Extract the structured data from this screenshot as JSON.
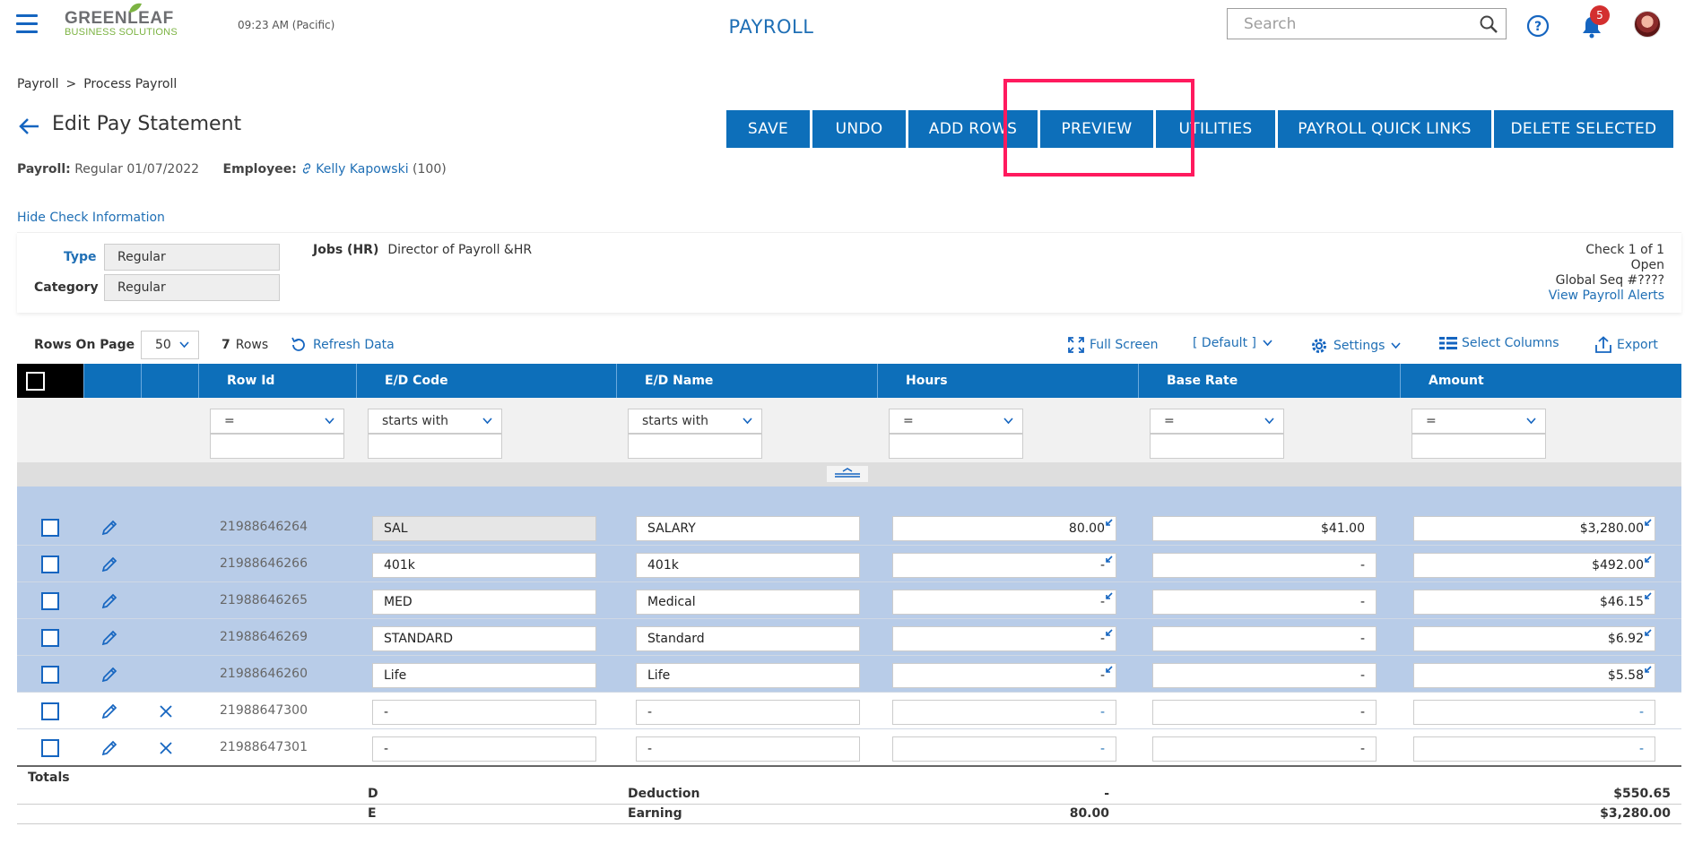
{
  "header": {
    "clock": "09:23 AM (Pacific)",
    "logo_top": "GREENLEAF",
    "logo_bottom": "BUSINESS SOLUTIONS",
    "app_title": "PAYROLL",
    "search_placeholder": "Search",
    "notification_count": "5"
  },
  "breadcrumb": {
    "root": "Payroll",
    "separator": ">",
    "current": "Process Payroll"
  },
  "page": {
    "title": "Edit Pay Statement"
  },
  "toolbar": {
    "buttons": [
      "SAVE",
      "UNDO",
      "ADD ROWS",
      "PREVIEW",
      "UTILITIES",
      "PAYROLL QUICK LINKS",
      "DELETE SELECTED"
    ]
  },
  "meta": {
    "payroll_label": "Payroll:",
    "payroll_value": "Regular 01/07/2022",
    "employee_label": "Employee:",
    "employee_name": "Kelly Kapowski",
    "employee_id": "(100)"
  },
  "check": {
    "hide_link": "Hide Check Information",
    "type_label": "Type",
    "type_value": "Regular",
    "category_label": "Category",
    "category_value": "Regular",
    "jobs_label": "Jobs (HR)",
    "jobs_value": "Director of Payroll &HR",
    "check_count": "Check 1 of 1",
    "status": "Open",
    "global_seq": "Global Seq #????",
    "alerts_link": "View Payroll Alerts"
  },
  "grid_toolbar": {
    "rows_on_page_label": "Rows On Page",
    "rows_on_page_value": "50",
    "row_count": "7",
    "rows_label": "Rows",
    "refresh": "Refresh Data",
    "full_screen": "Full Screen",
    "default_view": "[ Default ]",
    "settings": "Settings",
    "select_columns": "Select Columns",
    "export": "Export"
  },
  "columns": [
    "Row Id",
    "E/D Code",
    "E/D Name",
    "Hours",
    "Base Rate",
    "Amount"
  ],
  "filters": [
    "=",
    "starts with",
    "starts with",
    "=",
    "=",
    "="
  ],
  "rows": [
    {
      "id": "21988646264",
      "code": "SAL",
      "name": "SALARY",
      "hours": "80.00",
      "rate": "$41.00",
      "amount": "$3,280.00"
    },
    {
      "id": "21988646266",
      "code": "401k",
      "name": "401k",
      "hours": "-",
      "rate": "-",
      "amount": "$492.00"
    },
    {
      "id": "21988646265",
      "code": "MED",
      "name": "Medical",
      "hours": "-",
      "rate": "-",
      "amount": "$46.15"
    },
    {
      "id": "21988646269",
      "code": "STANDARD",
      "name": "Standard",
      "hours": "-",
      "rate": "-",
      "amount": "$6.92"
    },
    {
      "id": "21988646260",
      "code": "Life",
      "name": "Life",
      "hours": "-",
      "rate": "-",
      "amount": "$5.58"
    },
    {
      "id": "21988647300",
      "code": "-",
      "name": "-",
      "hours": "-",
      "rate": "-",
      "amount": "-"
    },
    {
      "id": "21988647301",
      "code": "-",
      "name": "-",
      "hours": "-",
      "rate": "-",
      "amount": "-"
    }
  ],
  "totals": {
    "label": "Totals",
    "deduction": {
      "code": "D",
      "name": "Deduction",
      "hours": "-",
      "amount": "$550.65"
    },
    "earning": {
      "code": "E",
      "name": "Earning",
      "hours": "80.00",
      "amount": "$3,280.00"
    }
  },
  "colors": {
    "primary": "#0d6fba",
    "selected_row": "#b8cce8",
    "highlight_box": "#ff1a5e",
    "badge": "#d32f2f"
  }
}
